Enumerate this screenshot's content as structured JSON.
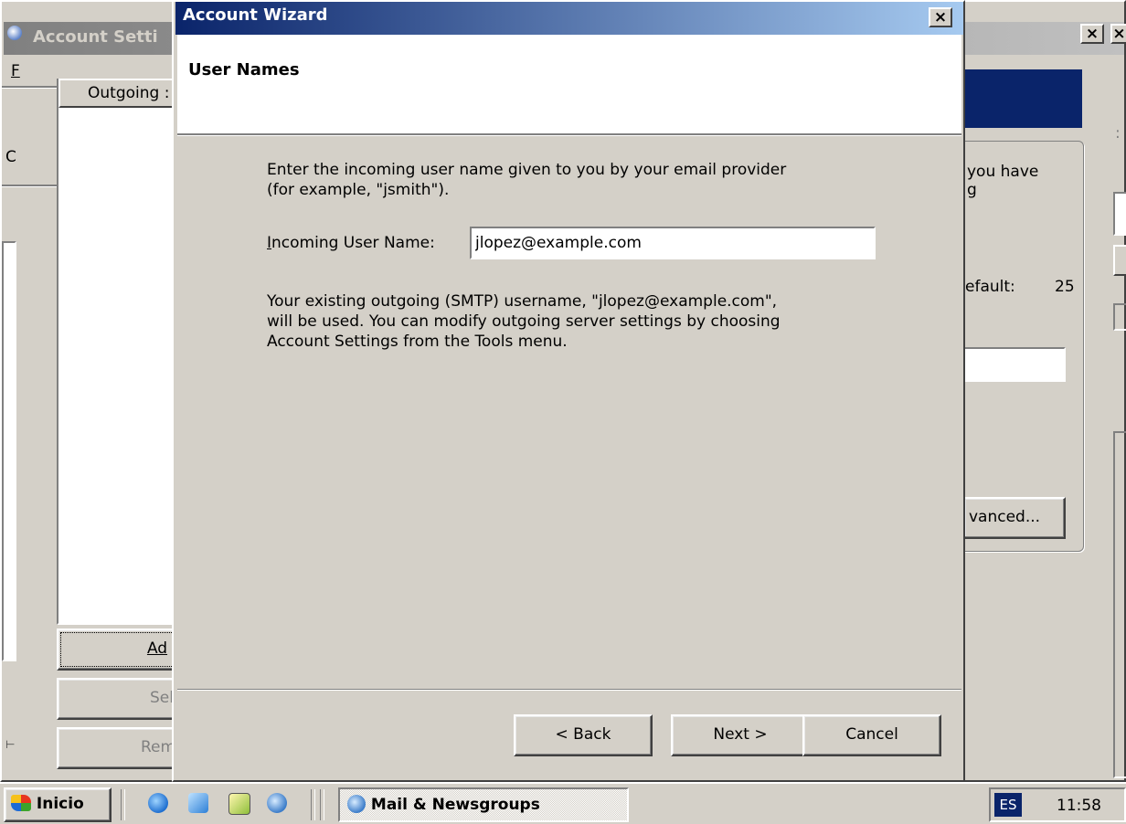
{
  "bg_window": {
    "title": "Account Setti",
    "menu_initial": "F",
    "list_header": "Outgoing :",
    "left_letter": "C",
    "add_button": "Ad",
    "set_button": "Sel",
    "remove_button": "Rem",
    "right_text_1": "you have",
    "right_text_2": "g",
    "default_label": "efault:",
    "default_value": "25",
    "advanced_button": "vanced..."
  },
  "wizard": {
    "title": "Account Wizard",
    "close_glyph": "×",
    "page_title": "User Names",
    "instruction_line1": "Enter the incoming user name given to you by your email provider",
    "instruction_line2": "(for example, \"jsmith\").",
    "username_label": "Incoming User Name:",
    "username_value": "jlopez@example.com",
    "info_line1": "Your existing outgoing (SMTP) username, \"jlopez@example.com\",",
    "info_line2": "will be used. You can modify outgoing server settings by choosing",
    "info_line3": "Account Settings from the Tools menu.",
    "back_button": "< Back",
    "next_button": "Next >",
    "cancel_button": "Cancel"
  },
  "taskbar": {
    "start_label": "Inicio",
    "task_label": "Mail & Newsgroups",
    "lang": "ES",
    "clock": "11:58"
  },
  "colors": {
    "title_active_start": "#0a246a",
    "title_active_end": "#a6caf0",
    "title_inactive": "#808080",
    "face": "#d4d0c8"
  }
}
